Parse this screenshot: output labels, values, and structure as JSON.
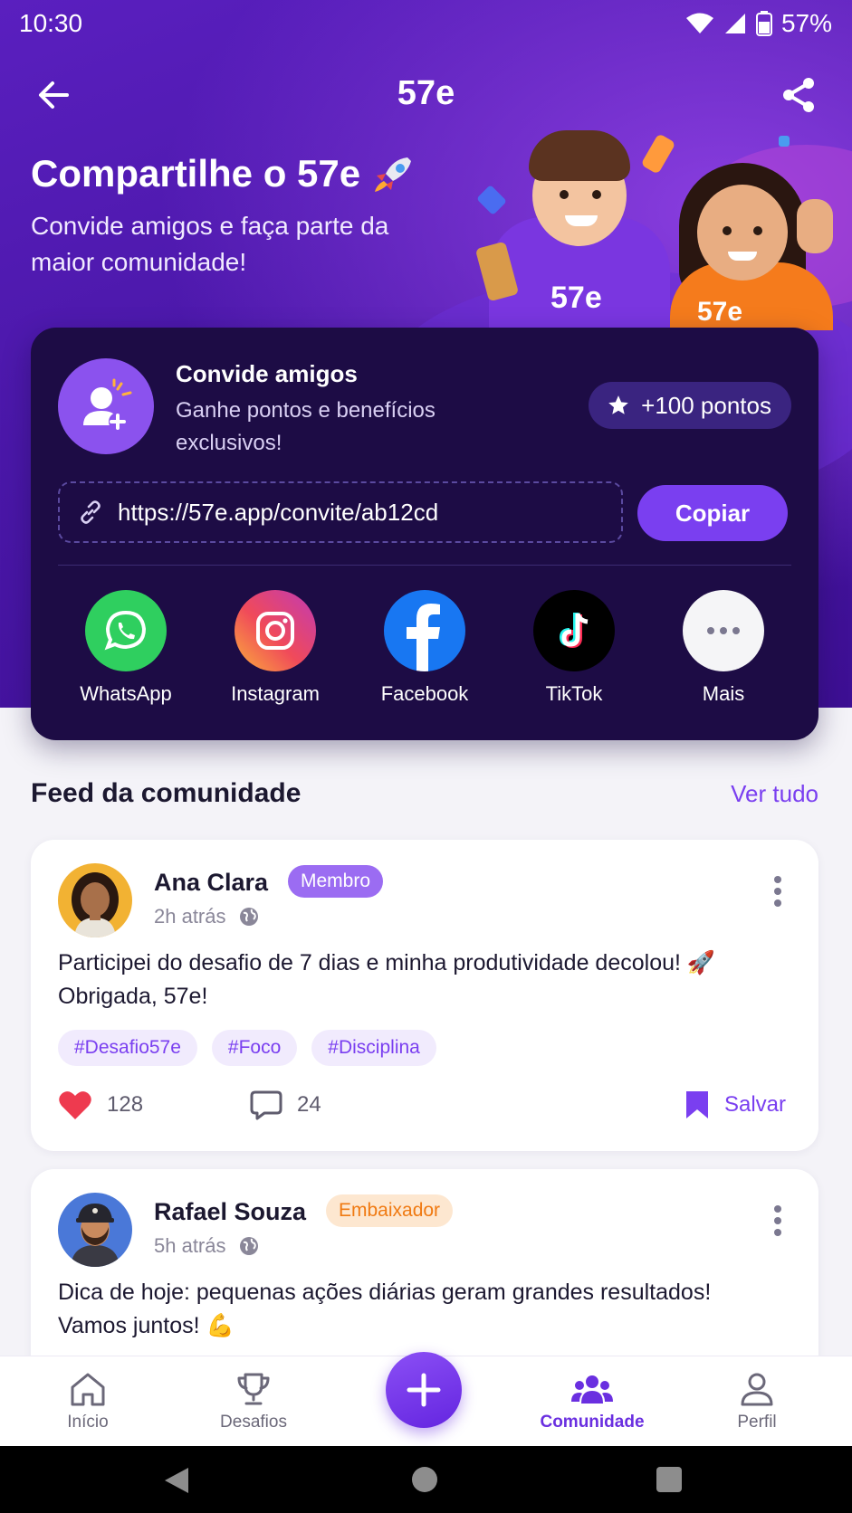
{
  "status": {
    "time": "10:30",
    "battery": "57%"
  },
  "header": {
    "title": "57e"
  },
  "hero": {
    "title": "Compartilhe o 57e",
    "subtitle": "Convide amigos e faça parte da maior comunidade!",
    "hoodie_text": "57e"
  },
  "invite": {
    "title": "Convide amigos",
    "subtitle": "Ganhe pontos e benefícios exclusivos!",
    "points": "+100 pontos",
    "link": "https://57e.app/convite/ab12cd",
    "copy_label": "Copiar",
    "socials": [
      {
        "label": "WhatsApp",
        "icon": "whatsapp-icon"
      },
      {
        "label": "Instagram",
        "icon": "instagram-icon"
      },
      {
        "label": "Facebook",
        "icon": "facebook-icon"
      },
      {
        "label": "TikTok",
        "icon": "tiktok-icon"
      },
      {
        "label": "Mais",
        "icon": "more-horizontal-icon"
      }
    ]
  },
  "feed": {
    "title": "Feed da comunidade",
    "see_all": "Ver tudo",
    "posts": [
      {
        "author": "Ana Clara",
        "badge": "Membro",
        "time": "2h atrás",
        "text": "Participei do desafio de 7 dias e minha produtividade decolou! 🚀 Obrigada, 57e!",
        "tags": [
          "#Desafio57e",
          "#Foco",
          "#Disciplina"
        ],
        "likes": "128",
        "comments": "24",
        "save_label": "Salvar"
      },
      {
        "author": "Rafael Souza",
        "badge": "Embaixador",
        "time": "5h atrás",
        "text": "Dica de hoje: pequenas ações diárias geram grandes resultados! Vamos juntos! 💪"
      }
    ]
  },
  "nav": {
    "items": [
      {
        "label": "Início",
        "icon": "home-icon"
      },
      {
        "label": "Desafios",
        "icon": "trophy-icon"
      },
      {
        "label": "Comunidade",
        "icon": "community-icon"
      },
      {
        "label": "Perfil",
        "icon": "profile-icon"
      }
    ]
  },
  "colors": {
    "accent": "#7a3ff0",
    "hero_bg": "#4a17a8",
    "card_bg": "#1d0c45",
    "badge_member": "#9b6cf2",
    "badge_ambassador": "#fde7d0"
  }
}
